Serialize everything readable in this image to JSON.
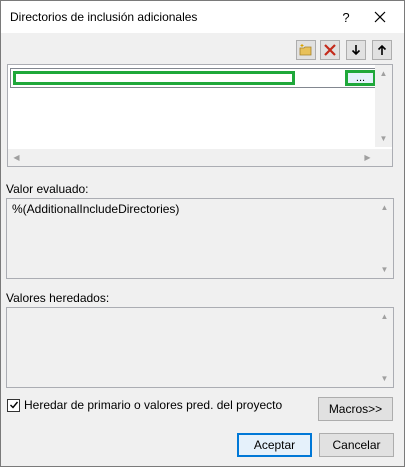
{
  "window": {
    "title": "Directorios de inclusión adicionales",
    "help_label": "?"
  },
  "toolbar": {
    "icons": [
      "new-folder-icon",
      "delete-icon",
      "move-down-icon",
      "move-up-icon"
    ]
  },
  "list": {
    "entry_value": "",
    "browse_label": "..."
  },
  "evaluated": {
    "label": "Valor evaluado:",
    "value": "%(AdditionalIncludeDirectories)"
  },
  "inherited": {
    "label": "Valores heredados:",
    "value": ""
  },
  "inherit_checkbox": {
    "label": "Heredar de primario o valores pred. del proyecto",
    "checked": true
  },
  "buttons": {
    "macros": "Macros>>",
    "accept": "Aceptar",
    "cancel": "Cancelar"
  },
  "colors": {
    "highlight": "#1fa83a",
    "default_button_border": "#0078d7",
    "delete_icon": "#c42b1c"
  }
}
